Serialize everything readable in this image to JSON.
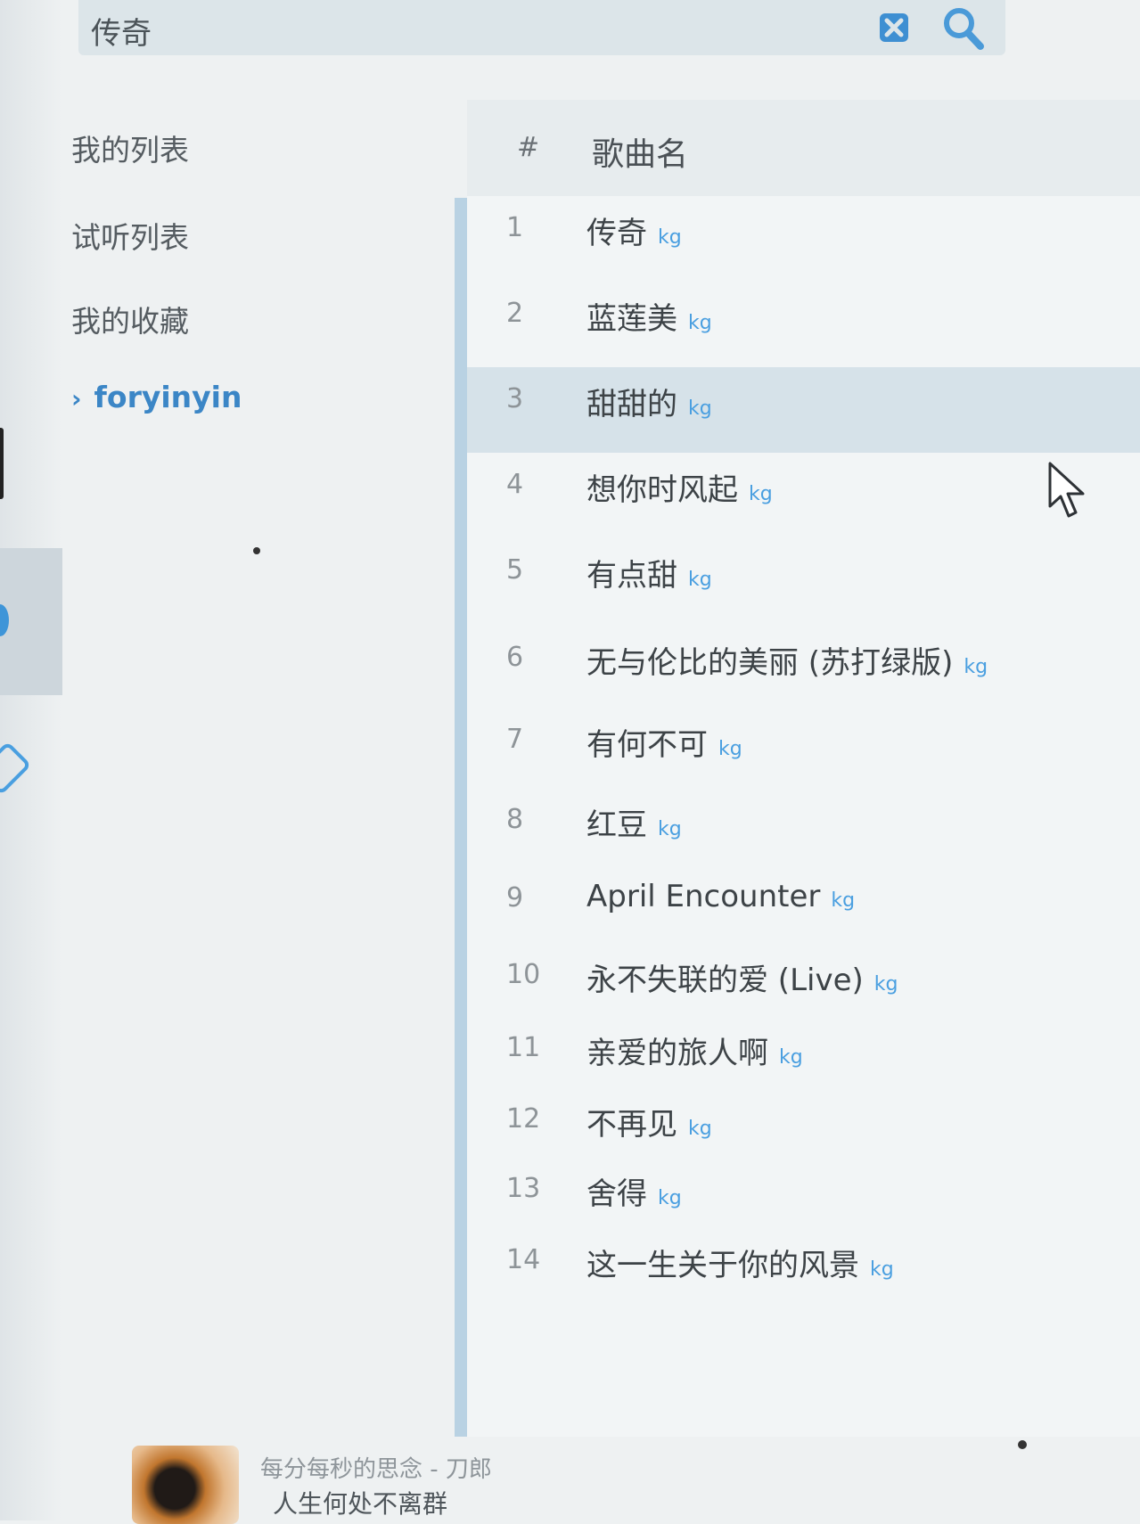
{
  "search": {
    "query": "传奇"
  },
  "sidebar": {
    "items": [
      {
        "label": "我的列表",
        "active": false
      },
      {
        "label": "试听列表",
        "active": false
      },
      {
        "label": "我的收藏",
        "active": false
      },
      {
        "label": "foryinyin",
        "active": true
      }
    ]
  },
  "tracklist": {
    "header": {
      "number": "#",
      "title": "歌曲名"
    },
    "hover_index": 3,
    "rows": [
      {
        "number": "1",
        "title": "传奇",
        "source": "kg"
      },
      {
        "number": "2",
        "title": "蓝莲美",
        "source": "kg"
      },
      {
        "number": "3",
        "title": "甜甜的",
        "source": "kg"
      },
      {
        "number": "4",
        "title": "想你时风起",
        "source": "kg"
      },
      {
        "number": "5",
        "title": "有点甜",
        "source": "kg"
      },
      {
        "number": "6",
        "title": "无与伦比的美丽 (苏打绿版)",
        "source": "kg"
      },
      {
        "number": "7",
        "title": "有何不可",
        "source": "kg"
      },
      {
        "number": "8",
        "title": "红豆",
        "source": "kg"
      },
      {
        "number": "9",
        "title": "April Encounter",
        "source": "kg"
      },
      {
        "number": "10",
        "title": "永不失联的爱 (Live)",
        "source": "kg"
      },
      {
        "number": "11",
        "title": "亲爱的旅人啊",
        "source": "kg"
      },
      {
        "number": "12",
        "title": "不再见",
        "source": "kg"
      },
      {
        "number": "13",
        "title": "舍得",
        "source": "kg"
      },
      {
        "number": "14",
        "title": "这一生关于你的风景",
        "source": "kg"
      }
    ]
  },
  "now_playing": {
    "line1": "每分每秒的思念 - 刀郎",
    "line2": "人生何处不离群"
  },
  "colors": {
    "accent": "#3b86c6",
    "source_tag": "#4a9fe0",
    "hover_row": "#d6e2e9"
  }
}
